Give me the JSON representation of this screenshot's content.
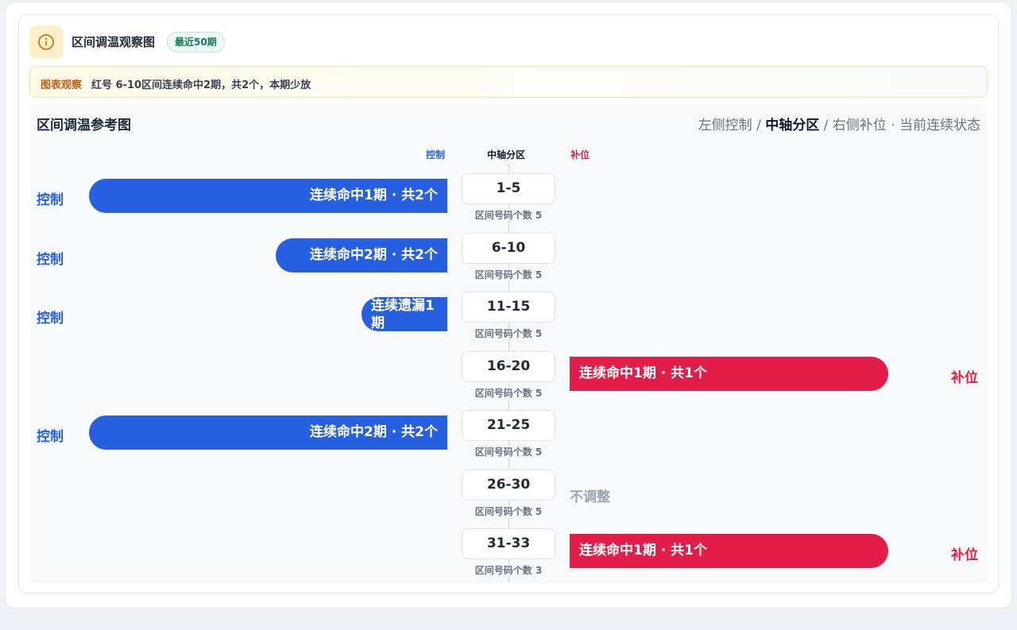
{
  "header": {
    "title": "区间调温观察图",
    "badge": "最近50期"
  },
  "notice": {
    "tag": "图表观察",
    "text": "红号 6-10区间连续命中2期，共2个，本期少放"
  },
  "panel": {
    "title": "区间调温参考图",
    "legend": {
      "left": "左侧控制",
      "sep1": " / ",
      "center": "中轴分区",
      "sep2": " / ",
      "right": "右侧补位",
      "sep3": " · ",
      "tail": "当前连续状态"
    },
    "columns": {
      "left": "控制",
      "center": "中轴分区",
      "right": "补位"
    }
  },
  "colors": {
    "control": "#2660e0",
    "fill": "#e11d48",
    "neutral": "#9ca3af"
  },
  "rows": [
    {
      "zone": "1-5",
      "count": "区间号码个数 5",
      "side": "control",
      "label": "控制",
      "text": "连续命中1期 · 共2个",
      "level": 1.0
    },
    {
      "zone": "6-10",
      "count": "区间号码个数 5",
      "side": "control",
      "label": "控制",
      "text": "连续命中2期 · 共2个",
      "level": 0.48
    },
    {
      "zone": "11-15",
      "count": "区间号码个数 5",
      "side": "control",
      "label": "控制",
      "text": "连续遗漏1期",
      "level": 0.24
    },
    {
      "zone": "16-20",
      "count": "区间号码个数 5",
      "side": "fill",
      "label": "补位",
      "text": "连续命中1期 · 共1个",
      "level": 1.0
    },
    {
      "zone": "21-25",
      "count": "区间号码个数 5",
      "side": "control",
      "label": "控制",
      "text": "连续命中2期 · 共2个",
      "level": 1.0
    },
    {
      "zone": "26-30",
      "count": "区间号码个数 5",
      "side": "none",
      "label": "",
      "text": "不调整",
      "level": 0
    },
    {
      "zone": "31-33",
      "count": "区间号码个数 3",
      "side": "fill",
      "label": "补位",
      "text": "连续命中1期 · 共1个",
      "level": 1.0
    }
  ]
}
